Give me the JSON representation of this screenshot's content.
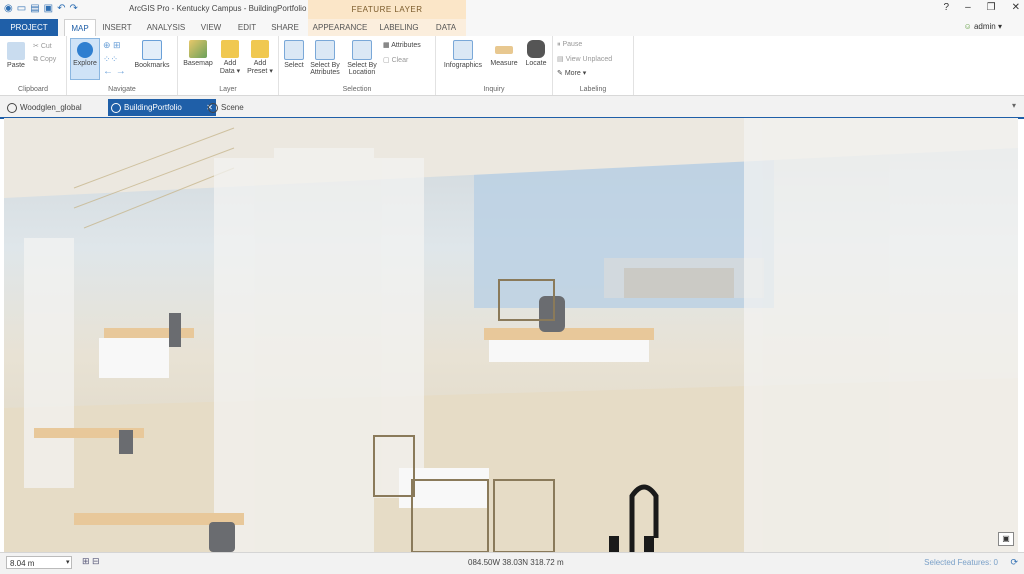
{
  "app_title": "ArcGIS Pro - Kentucky Campus - BuildingPortfolio",
  "contextual_header": "FEATURE LAYER",
  "window_controls": [
    "?",
    "–",
    "❐",
    "✕"
  ],
  "user": "admin ▾",
  "tabs": [
    "PROJECT",
    "MAP",
    "INSERT",
    "ANALYSIS",
    "VIEW",
    "EDIT",
    "SHARE",
    "APPEARANCE",
    "LABELING",
    "DATA"
  ],
  "ribbon": {
    "clipboard": {
      "label": "Clipboard",
      "paste": "Paste",
      "cut": "Cut",
      "copy": "Copy"
    },
    "navigate": {
      "label": "Navigate",
      "explore": "Explore",
      "bookmarks": "Bookmarks"
    },
    "layer": {
      "label": "Layer",
      "basemap": "Basemap",
      "add_data": "Add Data ▾",
      "add_preset": "Add Preset ▾"
    },
    "selection": {
      "label": "Selection",
      "select": "Select",
      "select_by_attributes": "Select By Attributes",
      "select_by_location": "Select By Location",
      "attributes": "Attributes",
      "clear": "Clear"
    },
    "inquiry": {
      "label": "Inquiry",
      "infographics": "Infographics",
      "measure": "Measure",
      "locate": "Locate"
    },
    "labeling": {
      "label": "Labeling",
      "pause": "Pause",
      "view_unplaced": "View Unplaced",
      "more": "More ▾"
    }
  },
  "view_tabs": [
    "Woodglen_global",
    "BuildingPortfolio",
    "Scene"
  ],
  "status": {
    "scale": "8.04 m",
    "coordinates": "084.50W 38.03N  318.72 m",
    "selected": "Selected Features: 0"
  },
  "colors": {
    "brand": "#1f5fa8",
    "context": "#fbe6c8"
  }
}
